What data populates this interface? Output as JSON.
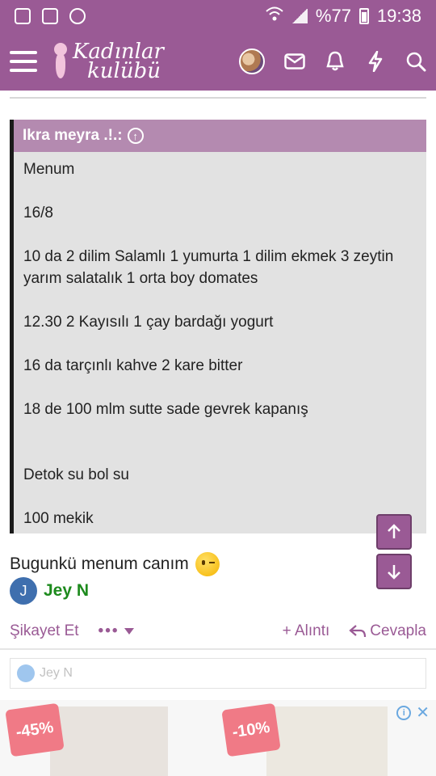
{
  "status_bar": {
    "battery": "%77",
    "time": "19:38"
  },
  "header": {
    "logo_line1": "Kadınlar",
    "logo_line2": "kulübü"
  },
  "quote": {
    "author": "Ikra meyra .!.:",
    "lines": [
      "Menum",
      "16/8",
      "10 da 2 dilim Salamlı 1 yumurta 1 dilim ekmek 3 zeytin yarım salatalık 1 orta boy domates",
      "12.30 2 Kayısılı 1 çay bardağı yogurt",
      "16 da tarçınlı kahve 2 kare bitter",
      "18 de 100 mlm sutte sade gevrek kapanış",
      "Detok su bol su",
      "100 mekik"
    ]
  },
  "post": {
    "text": "Bugunkü menum canım",
    "author_initial": "J",
    "author_name": "Jey N"
  },
  "actions": {
    "report": "Şikayet Et",
    "more": "•••",
    "quote": "+ Alıntı",
    "reply": "Cevapla"
  },
  "reactions": {
    "user": "Jey N"
  },
  "ad": {
    "badge1": "-45%",
    "badge2": "-10%"
  },
  "colors": {
    "brand": "#9a5a95",
    "quote_head": "#b48ab0",
    "author_green": "#1d8a1d"
  }
}
